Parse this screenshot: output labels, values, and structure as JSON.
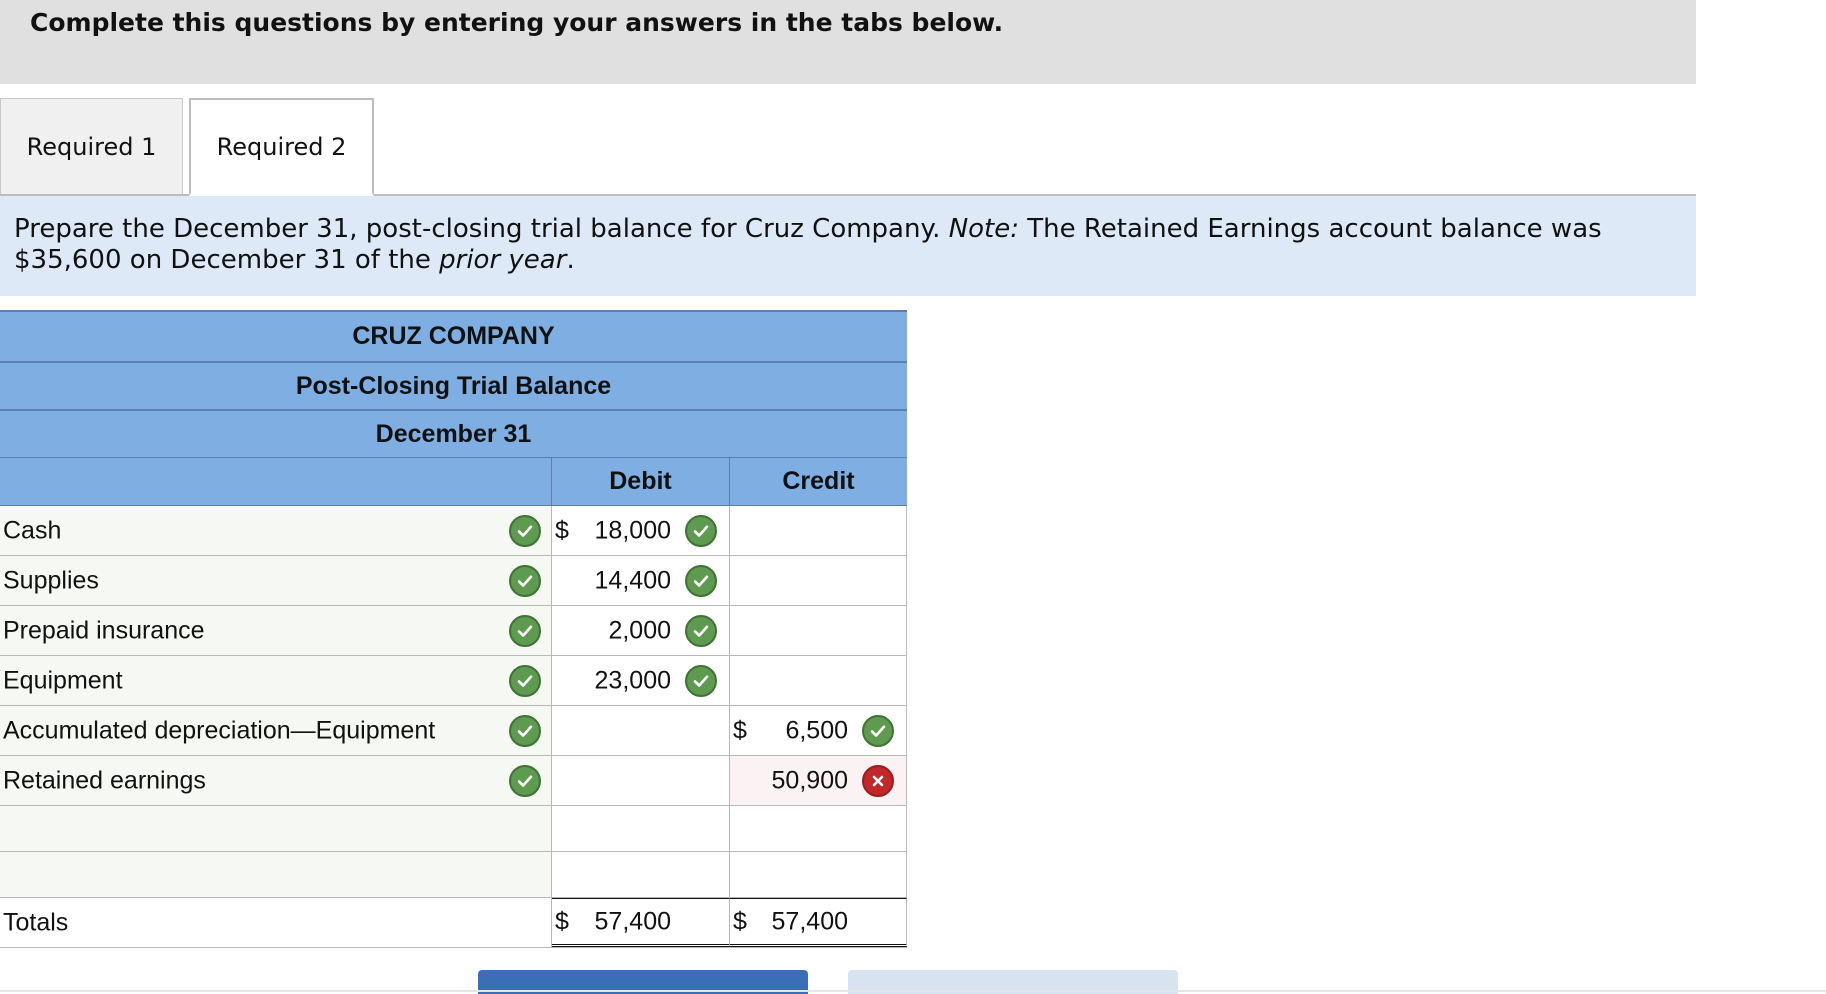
{
  "banner": {
    "text": "Complete this questions by entering your answers in the tabs below."
  },
  "tabs": [
    {
      "label": "Required 1",
      "active": false
    },
    {
      "label": "Required 2",
      "active": true
    }
  ],
  "instructions": {
    "part1": "Prepare the December 31, post-closing trial balance for Cruz Company. ",
    "note_label": "Note:",
    "part2": " The Retained Earnings account balance was $35,600 on December 31 of the ",
    "prior_year": "prior year",
    "part3": "."
  },
  "table": {
    "company": "CRUZ COMPANY",
    "statement": "Post-Closing Trial Balance",
    "date": "December 31",
    "columns": {
      "debit": "Debit",
      "credit": "Credit"
    },
    "rows": [
      {
        "account": "Cash",
        "debit_dollar": "$",
        "debit": "18,000",
        "credit_dollar": "",
        "credit": ""
      },
      {
        "account": "Supplies",
        "debit_dollar": "",
        "debit": "14,400",
        "credit_dollar": "",
        "credit": ""
      },
      {
        "account": "Prepaid insurance",
        "debit_dollar": "",
        "debit": "2,000",
        "credit_dollar": "",
        "credit": ""
      },
      {
        "account": "Equipment",
        "debit_dollar": "",
        "debit": "23,000",
        "credit_dollar": "",
        "credit": ""
      },
      {
        "account": "Accumulated depreciation—Equipment",
        "debit_dollar": "",
        "debit": "",
        "credit_dollar": "$",
        "credit": "6,500"
      },
      {
        "account": "Retained earnings",
        "debit_dollar": "",
        "debit": "",
        "credit_dollar": "",
        "credit": "50,900"
      },
      {
        "account": "",
        "debit_dollar": "",
        "debit": "",
        "credit_dollar": "",
        "credit": ""
      },
      {
        "account": "",
        "debit_dollar": "",
        "debit": "",
        "credit_dollar": "",
        "credit": ""
      }
    ],
    "totals": {
      "label": "Totals",
      "debit_dollar": "$",
      "debit": "57,400",
      "credit_dollar": "$",
      "credit": "57,400"
    }
  },
  "colors": {
    "header_blue": "#7faee2",
    "check_green": "#5e9a4f",
    "cross_red": "#c0282a",
    "banner_gray": "#e0e0e0",
    "instr_blue": "#dde9f7"
  }
}
